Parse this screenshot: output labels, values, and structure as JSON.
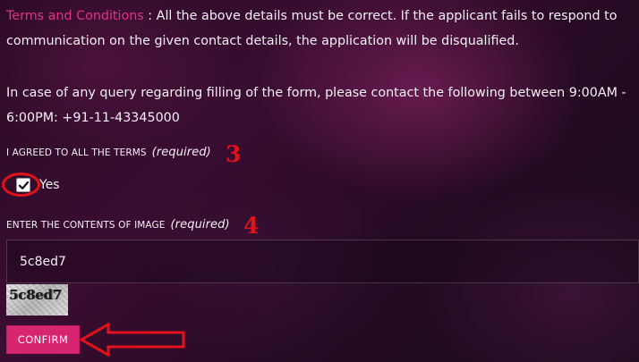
{
  "terms": {
    "link_text": "Terms and Conditions",
    "separator": " : ",
    "text": "All the above details must be correct. If the applicant fails to respond to communication on the given contact details, the application will be disqualified."
  },
  "contact": {
    "text": "In case of any query regarding filling of the form, please contact the following between 9:00AM - 6:00PM: +91-11-43345000"
  },
  "agree_field": {
    "label": "I AGREED TO ALL THE TERMS",
    "required": "(required)",
    "option_label": "Yes",
    "checked": true,
    "step_marker": "3"
  },
  "captcha_field": {
    "label": "ENTER THE CONTENTS OF IMAGE",
    "required": "(required)",
    "value": "5c8ed7",
    "image_text": "5c8ed7",
    "step_marker": "4"
  },
  "confirm_button": {
    "label": "CONFIRM"
  },
  "annotations": {
    "color": "#e3121a",
    "icons": [
      "circle-highlight",
      "arrow-left-icon"
    ]
  },
  "colors": {
    "accent": "#e0338a",
    "button": "#d8256f"
  }
}
